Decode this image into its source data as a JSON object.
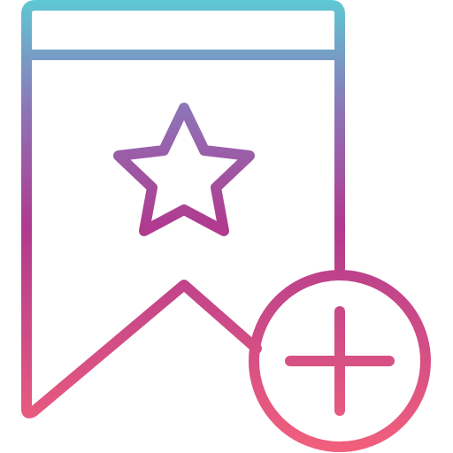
{
  "icon": {
    "name": "add-bookmark-icon",
    "parts": {
      "bookmark": "bookmark-icon",
      "star": "star-icon",
      "plus_circle": "plus-circle-icon"
    },
    "gradient": {
      "top": "#5ec8d4",
      "upper_mid": "#8e72b6",
      "mid": "#b03a8f",
      "bottom": "#f2607c"
    }
  }
}
